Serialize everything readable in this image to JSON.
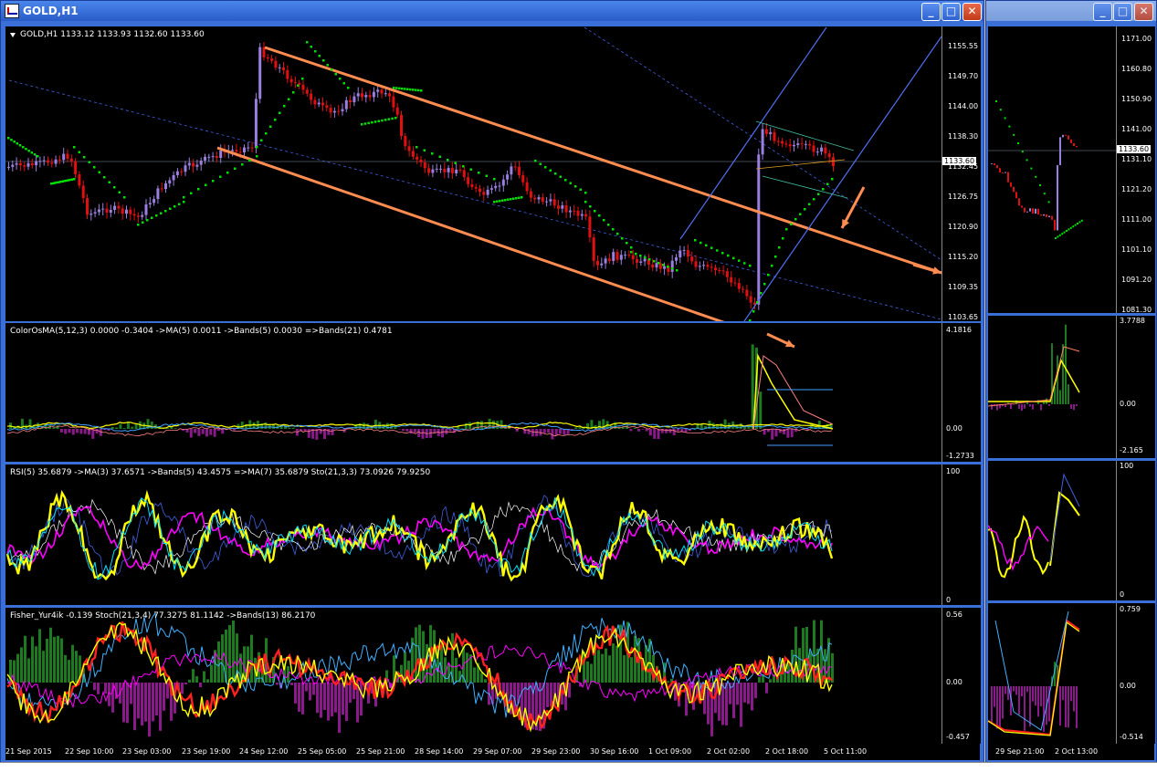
{
  "main_window": {
    "title": "GOLD,H1",
    "buttons": {
      "minimize": "_",
      "maximize": "□",
      "close": "✕"
    },
    "header": "GOLD,H1  1133.12 1133.93 1132.60 1133.60",
    "current_price": "1133.60",
    "price_ticks": [
      "1155.55",
      "1149.70",
      "1144.00",
      "1138.30",
      "1132.45",
      "1126.75",
      "1120.90",
      "1115.20",
      "1109.35",
      "1103.65"
    ],
    "osma_label": "ColorOsMA(5,12,3) 0.0000 -0.3404  ->MA(5) 0.0011  ->Bands(5) 0.0030  =>Bands(21) 0.4781",
    "osma_ticks": [
      "4.1816",
      "0.00",
      "-1.2733"
    ],
    "rsi_label": "RSI(5) 35.6879  ->MA(3) 37.6571  ->Bands(5) 43.4575  =>MA(7) 35.6879  Sto(21,3,3) 73.0926 79.9250",
    "rsi_ticks": [
      "100",
      "0"
    ],
    "fisher_label": "Fisher_Yur4ik -0.139  Stoch(21,3,4) 77.3275 81.1142  ->Bands(13) 86.2170",
    "fisher_ticks": [
      "0.56",
      "0.00",
      "-0.457"
    ],
    "time_labels": [
      "21 Sep 2015",
      "22 Sep 10:00",
      "23 Sep 03:00",
      "23 Sep 19:00",
      "24 Sep 12:00",
      "25 Sep 05:00",
      "25 Sep 21:00",
      "28 Sep 14:00",
      "29 Sep 07:00",
      "29 Sep 23:00",
      "30 Sep 16:00",
      "1 Oct 09:00",
      "2 Oct 02:00",
      "2 Oct 18:00",
      "5 Oct 11:00"
    ]
  },
  "side_window": {
    "buttons": {
      "minimize": "_",
      "maximize": "□",
      "close": "✕"
    },
    "current_price": "1133.60",
    "price_ticks": [
      "1171.00",
      "1160.80",
      "1150.90",
      "1141.00",
      "1131.10",
      "1121.20",
      "1111.00",
      "1101.10",
      "1091.20",
      "1081.30"
    ],
    "osma_ticks": [
      "3.7788",
      "0.00",
      "-2.165"
    ],
    "rsi_ticks": [
      "100",
      "0"
    ],
    "fisher_ticks": [
      "0.759",
      "0.00",
      "-0.514"
    ],
    "time_labels": [
      "29 Sep 21:00",
      "2 Oct 13:00"
    ]
  },
  "colors": {
    "bull": "#9a7fe0",
    "bear": "#e01010",
    "psar": "#00e000",
    "channel": "#ff8c50",
    "pitchfork": "#4060e0",
    "yellow": "#ffff00",
    "magenta": "#ff00ff",
    "green_hist": "#1e7a1e",
    "purple_hist": "#8a1a8a"
  }
}
